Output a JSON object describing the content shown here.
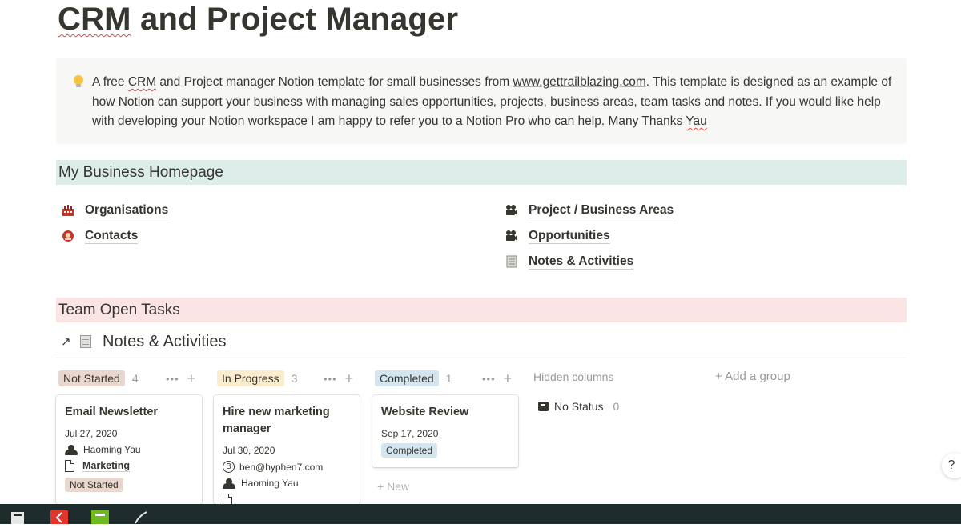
{
  "page": {
    "title_crm": "CRM",
    "title_rest": " and Project Manager"
  },
  "callout": {
    "t1": "A free ",
    "t2": "CRM",
    "t3": " and Project manager Notion template for small businesses from ",
    "link": "www.gettrailblazing.com",
    "t4": ". This template is designed as an example of how Notion can support your business with managing sales opportunities, projects, business areas, team tasks and notes. If you would like help with developing your Notion workspace I am happy to refer you to a Notion Pro who can help. Many Thanks ",
    "t5": "Yau"
  },
  "sections": {
    "homepage": "My Business Homepage",
    "tasks": "Team Open Tasks"
  },
  "links": {
    "organisations": "Organisations",
    "contacts": "Contacts",
    "projects": "Project / Business Areas",
    "opportunities": "Opportunities",
    "notes": "Notes & Activities"
  },
  "database": {
    "arrow": "↗",
    "title": "Notes & Activities"
  },
  "board": {
    "columns": [
      {
        "label": "Not Started",
        "count": "4"
      },
      {
        "label": "In Progress",
        "count": "3"
      },
      {
        "label": "Completed",
        "count": "1"
      }
    ],
    "dots": "•••",
    "plus": "+",
    "hidden_columns": "Hidden columns",
    "add_group": "+ Add a group",
    "no_status": {
      "label": "No Status",
      "count": "0"
    },
    "new": "+ New"
  },
  "cards": [
    {
      "title": "Email Newsletter",
      "date": "Jul 27, 2020",
      "person": "Haoming Yau",
      "relation": "Marketing",
      "status": "Not Started"
    },
    {
      "title": "Hire new marketing manager",
      "date": "Jul 30, 2020",
      "email_icon": "B",
      "email": "ben@hyphen7.com",
      "person": "Haoming Yau"
    },
    {
      "title": "Website Review",
      "date": "Sep 17, 2020",
      "status": "Completed"
    }
  ],
  "help": "?",
  "colors": {
    "not_started": "#e9d6cc",
    "in_progress": "#fbeccd",
    "completed": "#d3e5ef",
    "homepage_bar": "#ddedea",
    "tasks_bar": "#fbe4e4"
  }
}
